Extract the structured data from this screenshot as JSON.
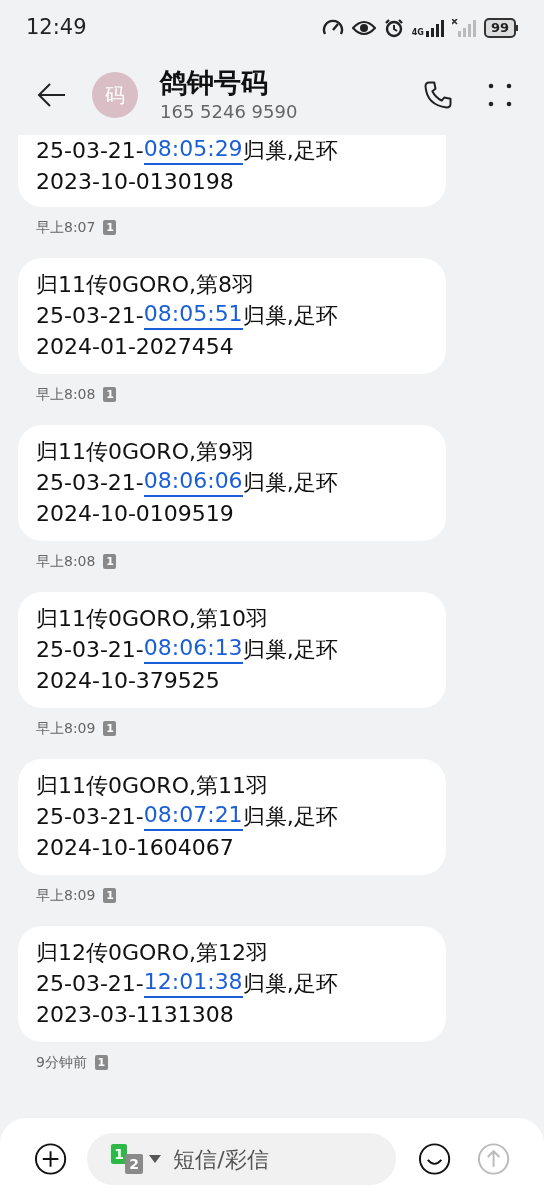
{
  "status_bar": {
    "time": "12:49",
    "network": "4G",
    "battery": "99"
  },
  "header": {
    "avatar": "码",
    "name": "鸽钟号码",
    "number": "165 5246 9590"
  },
  "messages": [
    {
      "date": "25-03-21-",
      "clock": "08:05:29",
      "note": "归巢,足环",
      "ring": "2023-10-0130198",
      "time": "早上8:07",
      "sim": "1"
    },
    {
      "heading": "归11传0GORO,第8羽",
      "date": "25-03-21-",
      "clock": "08:05:51",
      "note": "归巢,足环",
      "ring": "2024-01-2027454",
      "time": "早上8:08",
      "sim": "1"
    },
    {
      "heading": "归11传0GORO,第9羽",
      "date": "25-03-21-",
      "clock": "08:06:06",
      "note": "归巢,足环",
      "ring": "2024-10-0109519",
      "time": "早上8:08",
      "sim": "1"
    },
    {
      "heading": "归11传0GORO,第10羽",
      "date": "25-03-21-",
      "clock": "08:06:13",
      "note": "归巢,足环",
      "ring": "2024-10-379525",
      "time": "早上8:09",
      "sim": "1"
    },
    {
      "heading": "归11传0GORO,第11羽",
      "date": "25-03-21-",
      "clock": "08:07:21",
      "note": "归巢,足环",
      "ring": "2024-10-1604067",
      "time": "早上8:09",
      "sim": "1"
    },
    {
      "heading": "归12传0GORO,第12羽",
      "date": "25-03-21-",
      "clock": "12:01:38",
      "note": "归巢,足环",
      "ring": "2023-03-1131308",
      "time": "9分钟前",
      "sim": "1"
    }
  ],
  "composer": {
    "sim_primary": "1",
    "sim_secondary": "2",
    "placeholder": "短信/彩信"
  }
}
